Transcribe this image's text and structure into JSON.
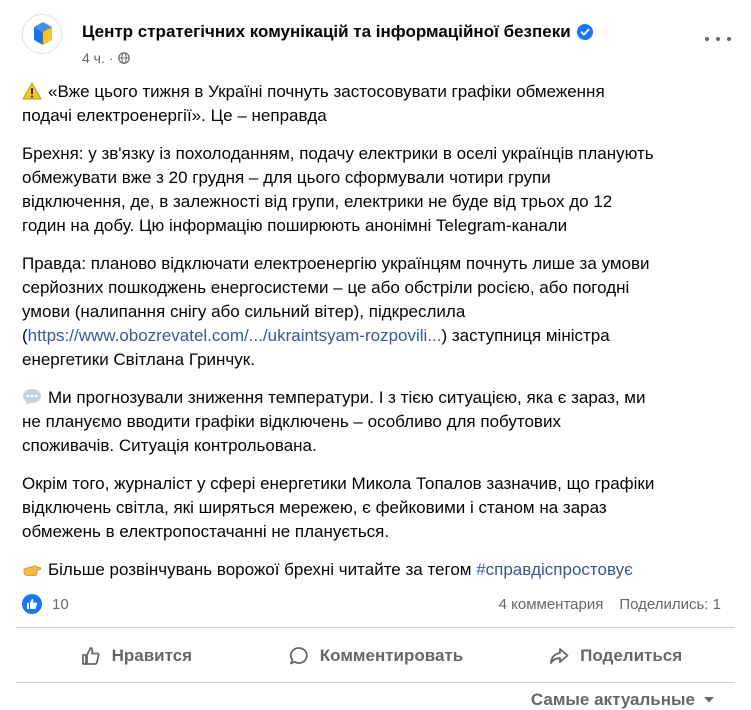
{
  "post": {
    "author": "Центр стратегічних комунікацій та інформаційної безпеки",
    "time": "4 ч.",
    "dot": "·",
    "paragraphs": {
      "p1": "«Вже цього тижня в Україні почнуть застосовувати графіки обмеження\nподачі електроенергії». Це – неправда",
      "p2": "Брехня: у зв'язку із похолоданням, подачу електрики в оселі українців планують\nобмежувати вже з 20 грудня – для цього сформували чотири групи\nвідключення, де, в залежності від групи, електрики не буде від трьох до 12\nгодин на добу. Цю інформацію поширюють анонімні Telegram-канали",
      "p3_before": "Правда: планово відключати електроенергію українцям почнуть лише за умови\nсерйозних пошкоджень енергосистеми – це або обстріли росією, або погодні\nумови (налипання снігу або сильний вітер), підкреслила\n(",
      "p3_link": "https://www.obozrevatel.com/.../ukraintsyam-rozpovili...",
      "p3_after": ") заступниця міністра\nенергетики Світлана Гринчук.",
      "p4": "Ми прогнозували зниження температури. І з тією ситуацією, яка є зараз, ми\nне плануємо вводити графіки відключень – особливо для побутових\nспоживачів. Ситуація контрольована.",
      "p5": "Окрім того, журналіст у сфері енергетики Микола Топалов зазначив, що графіки\nвідключень світла, які ширяться мережею, є фейковими і станом на зараз\nобмежень в електропостачанні не планується.",
      "p6_text": "Більше розвінчувань ворожої брехні читайте за тегом ",
      "p6_tag": "#справдіспростовує"
    }
  },
  "stats": {
    "likes": "10",
    "comments": "4 комментария",
    "shares": "Поделились: 1"
  },
  "actions": {
    "like": "Нравится",
    "comment": "Комментировать",
    "share": "Поделиться"
  },
  "sort": {
    "label": "Самые актуальные"
  },
  "icons": {
    "avatar": "ukraine-flag-logo",
    "verified": "verified-badge-icon",
    "privacy": "globe-icon",
    "warning": "warning-emoji",
    "speech": "speech-balloon-emoji",
    "pointing": "pointing-hand-emoji"
  },
  "colors": {
    "accent": "#1877f2",
    "link": "#385898",
    "secondary_text": "#65676b"
  }
}
